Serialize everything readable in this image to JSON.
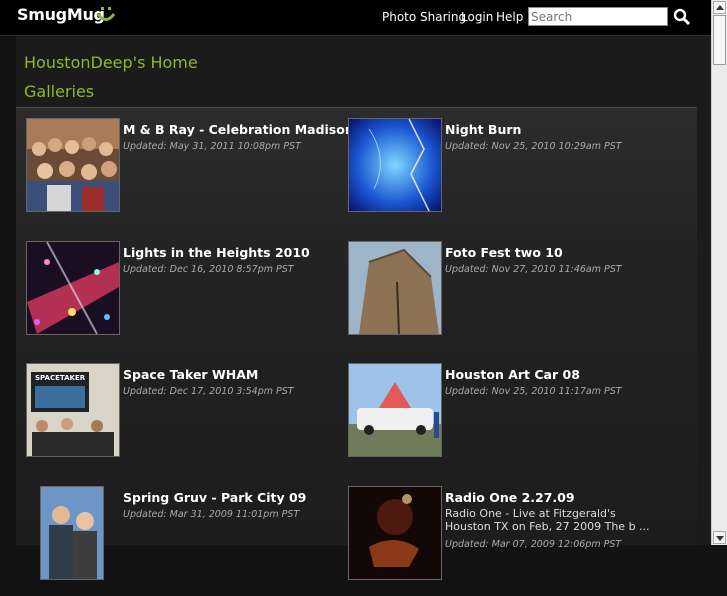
{
  "header": {
    "logo": "SmugMug",
    "nav": [
      "Photo Sharing",
      "Login",
      "Help"
    ],
    "search_placeholder": "Search"
  },
  "page": {
    "home_title": "HoustonDeep's Home",
    "galleries_heading": "Galleries"
  },
  "galleries": [
    {
      "title": "M & B Ray - Celebration Madison",
      "updated": "Updated: May 31, 2011 10:08pm PST"
    },
    {
      "title": "Night Burn",
      "updated": "Updated: Nov 25, 2010 10:29am PST"
    },
    {
      "title": "Lights in the Heights 2010",
      "updated": "Updated: Dec 16, 2010 8:57pm PST"
    },
    {
      "title": "Foto Fest two 10",
      "updated": "Updated: Nov 27, 2010 11:46am PST"
    },
    {
      "title": "Space Taker WHAM",
      "updated": "Updated: Dec 17, 2010 3:54pm PST",
      "thumb_text": "SPACETAKER"
    },
    {
      "title": "Houston Art Car 08",
      "updated": "Updated: Nov 25, 2010 11:17am PST"
    },
    {
      "title": "Spring Gruv - Park City 09",
      "updated": "Updated: Mar 31, 2009 11:01pm PST"
    },
    {
      "title": "Radio One 2.27.09",
      "description": "Radio One - Live at Fitzgerald's Houston TX on Feb, 27 2009 The b ...",
      "updated": "Updated: Mar 07, 2009 12:06pm PST"
    }
  ],
  "colors": {
    "accent": "#8fb82c",
    "background": "#121212"
  },
  "icons": {
    "search": "search-icon",
    "logo": "smile-icon"
  }
}
